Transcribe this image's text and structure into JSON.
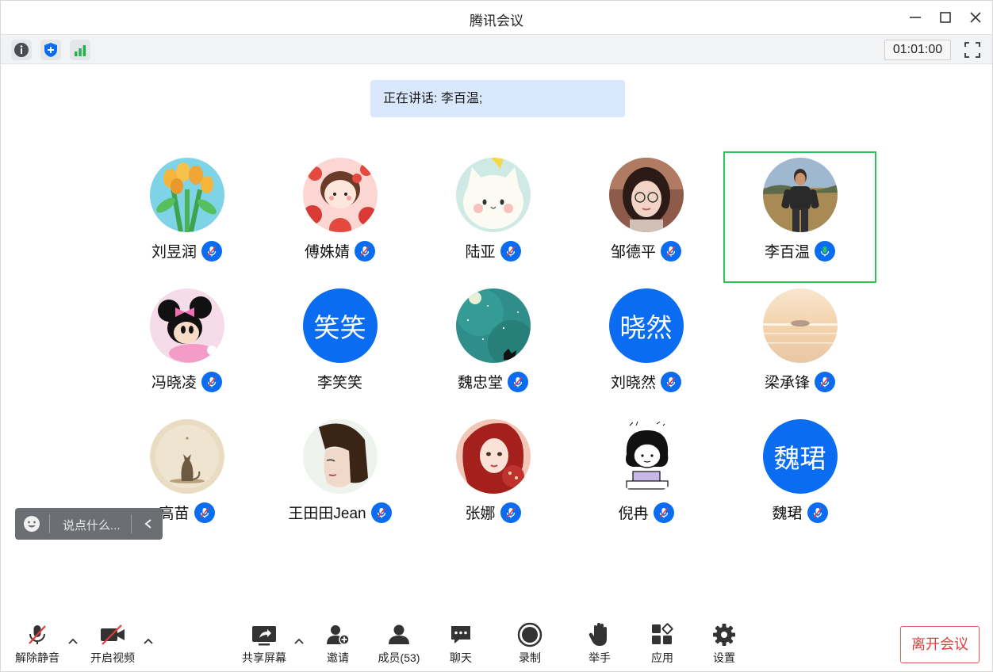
{
  "window": {
    "title": "腾讯会议"
  },
  "status_bar": {
    "timer": "01:01:00"
  },
  "speaking": {
    "prefix": "正在讲话:",
    "names": "李百温;"
  },
  "participants": [
    {
      "name": "刘昱润",
      "avatar_type": "photo",
      "avatar_theme": "tulips"
    },
    {
      "name": "傅姝婧",
      "avatar_type": "photo",
      "avatar_theme": "cartoon-girl-red"
    },
    {
      "name": "陆亚",
      "avatar_type": "photo",
      "avatar_theme": "white-cat"
    },
    {
      "name": "邹德平",
      "avatar_type": "photo",
      "avatar_theme": "woman-glasses"
    },
    {
      "name": "李百温",
      "avatar_type": "photo",
      "avatar_theme": "man-field",
      "speaking": true
    },
    {
      "name": "冯晓凌",
      "avatar_type": "photo",
      "avatar_theme": "minnie"
    },
    {
      "name": "李笑笑",
      "avatar_type": "text",
      "avatar_text": "笑笑"
    },
    {
      "name": "魏忠堂",
      "avatar_type": "photo",
      "avatar_theme": "teal-sky"
    },
    {
      "name": "刘晓然",
      "avatar_type": "text",
      "avatar_text": "晓然"
    },
    {
      "name": "梁承锋",
      "avatar_type": "photo",
      "avatar_theme": "sunset-sea"
    },
    {
      "name": "高苗",
      "avatar_type": "photo",
      "avatar_theme": "cat-sketch"
    },
    {
      "name": "王田田Jean",
      "avatar_type": "photo",
      "avatar_theme": "bob-hair-portrait"
    },
    {
      "name": "张娜",
      "avatar_type": "photo",
      "avatar_theme": "red-hair-girl"
    },
    {
      "name": "倪冉",
      "avatar_type": "photo",
      "avatar_theme": "doodle-girl"
    },
    {
      "name": "魏珺",
      "avatar_type": "text",
      "avatar_text": "魏珺"
    }
  ],
  "chat_input": {
    "placeholder": "说点什么..."
  },
  "toolbar": {
    "unmute": "解除静音",
    "start_video": "开启视频",
    "share_screen": "共享屏幕",
    "invite": "邀请",
    "members": "成员(53)",
    "chat": "聊天",
    "record": "录制",
    "raise_hand": "举手",
    "apps": "应用",
    "settings": "设置",
    "leave": "离开会议"
  },
  "colors": {
    "accent": "#0a6cf0",
    "speaking_border": "#2cc45a",
    "speaking_mic": "#2cc45a",
    "leave": "#e23c3c",
    "banner": "#d9e8fc"
  }
}
